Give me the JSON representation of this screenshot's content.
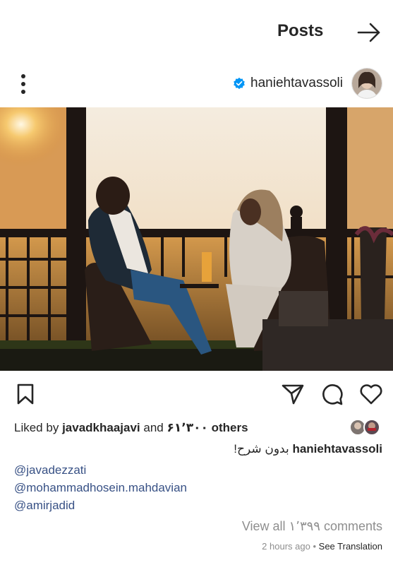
{
  "header": {
    "title": "Posts",
    "next_icon": "arrow-right-icon"
  },
  "post": {
    "username": "haniehtavassoli",
    "verified": true,
    "more_icon": "more-vertical-icon",
    "photo_alt": "couple sitting on balcony at sunset"
  },
  "actions": {
    "save_icon": "bookmark-icon",
    "share_icon": "send-icon",
    "comment_icon": "comment-icon",
    "like_icon": "heart-icon"
  },
  "likes": {
    "prefix": "Liked by",
    "user": "javadkhaajavi",
    "and": "and",
    "count_others": "۶۱٬۳۰۰ others"
  },
  "caption": {
    "username": "haniehtavassoli",
    "text": "بدون شرح!"
  },
  "mentions": [
    "@javadezzati",
    "@mohammadhosein.mahdavian",
    "@amirjadid"
  ],
  "comments": {
    "view_all": "View all ۱٬۳۹۹ comments"
  },
  "meta": {
    "time": "2 hours ago",
    "separator": "•",
    "see_translation": "See Translation"
  },
  "colors": {
    "text": "#262626",
    "secondary": "#8e8e8e",
    "link": "#385185",
    "verified": "#0095f6"
  }
}
